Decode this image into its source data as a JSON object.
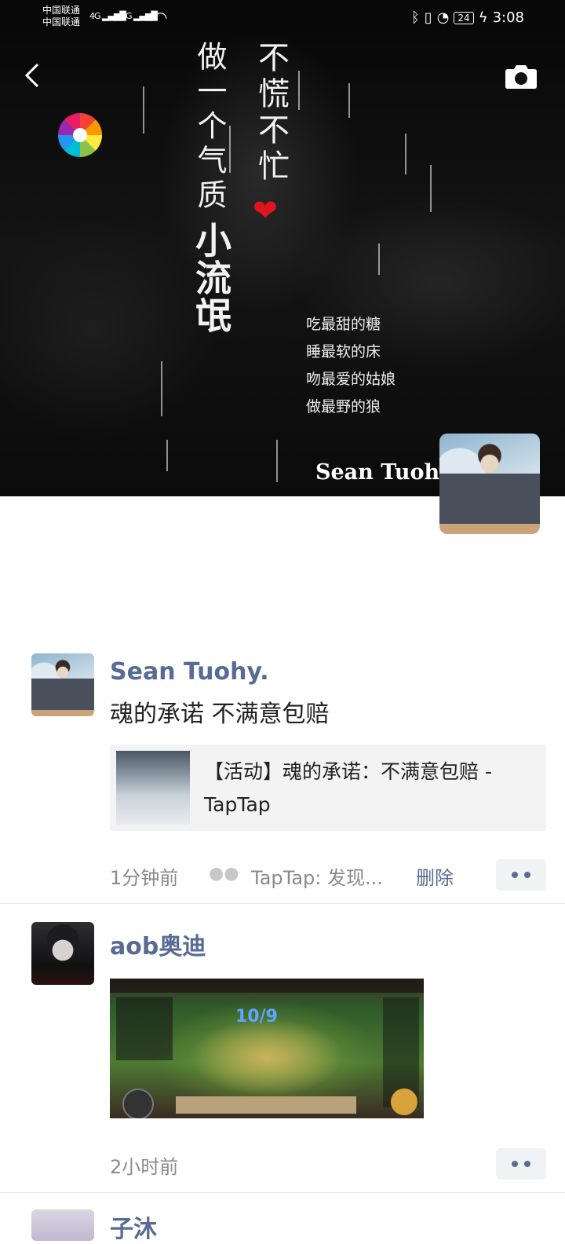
{
  "status_bar": {
    "carrier_1": "中国联通",
    "carrier_2": "中国联通",
    "network_1": "4G",
    "network_2": "4G",
    "battery": "24",
    "time": "3:08"
  },
  "cover": {
    "poster_line_1": "不慌不忙",
    "poster_line_2": "做一个气质",
    "poster_line_3": "小流氓",
    "poem": [
      "吃最甜的糖",
      "睡最软的床",
      "吻最爱的姑娘",
      "做最野的狼"
    ],
    "profile_name": "Sean Tuohy."
  },
  "posts": [
    {
      "author": "Sean Tuohy.",
      "text": "魂的承诺 不满意包赔",
      "link_title": "【活动】魂的承诺：不满意包赔 - TapTap",
      "time": "1分钟前",
      "source": "TapTap: 发现...",
      "delete_label": "删除"
    },
    {
      "author": "aob奥迪",
      "time": "2小时前",
      "game_score": "10/9"
    },
    {
      "author": "子沐"
    }
  ],
  "colors": {
    "link_blue": "#576b95",
    "time_gray": "#8a8a8a",
    "heart_red": "#e0141e"
  }
}
